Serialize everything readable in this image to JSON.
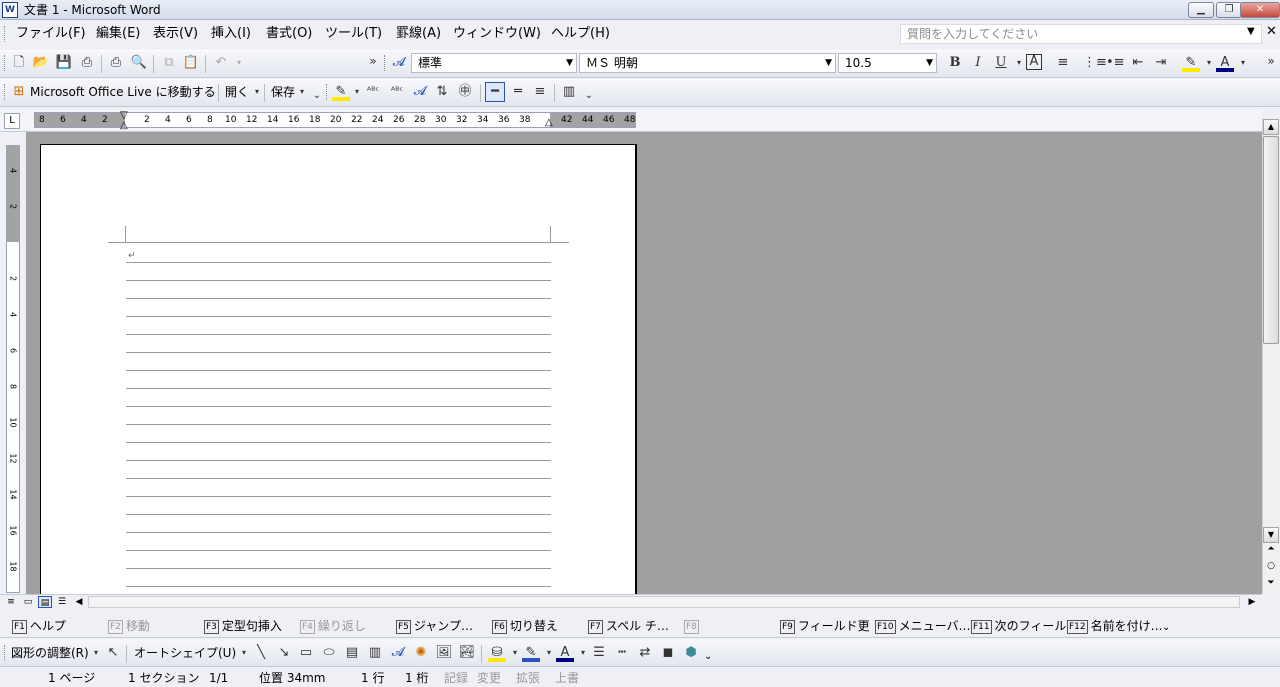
{
  "window": {
    "title": "文書 1 - Microsoft Word",
    "icon": "word-doc-icon",
    "minimize": "minimize-icon",
    "restore": "restore-icon",
    "close": "close-icon"
  },
  "menu": {
    "items": [
      "ファイル(F)",
      "編集(E)",
      "表示(V)",
      "挿入(I)",
      "書式(O)",
      "ツール(T)",
      "罫線(A)",
      "ウィンドウ(W)",
      "ヘルプ(H)"
    ],
    "question_placeholder": "質問を入力してください"
  },
  "formatting": {
    "style": "標準",
    "font": "ＭＳ 明朝",
    "size": "10.5",
    "bold": "B",
    "italic": "I",
    "underline": "U"
  },
  "web_toolbar": {
    "office_live": "Microsoft Office Live に移動する",
    "open": "開く",
    "save": "保存"
  },
  "ruler": {
    "h_labels": [
      "8",
      "6",
      "4",
      "2",
      "2",
      "4",
      "6",
      "8",
      "10",
      "12",
      "14",
      "16",
      "18",
      "20",
      "22",
      "24",
      "26",
      "28",
      "30",
      "32",
      "34",
      "36",
      "38",
      "42",
      "44",
      "46",
      "48"
    ],
    "v_labels": [
      "4",
      "2",
      "2",
      "4",
      "6",
      "8",
      "10",
      "12",
      "14",
      "16",
      "18"
    ],
    "tab_selector": "L"
  },
  "fkeys": [
    {
      "key": "F1",
      "label": "ヘルプ",
      "enabled": true
    },
    {
      "key": "F2",
      "label": "移動",
      "enabled": false
    },
    {
      "key": "F3",
      "label": "定型句挿入",
      "enabled": true
    },
    {
      "key": "F4",
      "label": "繰り返し",
      "enabled": false
    },
    {
      "key": "F5",
      "label": "ジャンプ…",
      "enabled": true
    },
    {
      "key": "F6",
      "label": "切り替え",
      "enabled": true
    },
    {
      "key": "F7",
      "label": "スペル チ…",
      "enabled": true
    },
    {
      "key": "F8",
      "label": "",
      "enabled": false
    },
    {
      "key": "F9",
      "label": "フィールド更",
      "enabled": true
    },
    {
      "key": "F10",
      "label": "メニューバ…",
      "enabled": true
    },
    {
      "key": "F11",
      "label": "次のフィール",
      "enabled": true
    },
    {
      "key": "F12",
      "label": "名前を付け…",
      "enabled": true
    }
  ],
  "drawing": {
    "adjust": "図形の調整(R)",
    "autoshape": "オートシェイプ(U)"
  },
  "status": {
    "page": "1 ページ",
    "section": "1 セクション",
    "pages": "1/1",
    "position": "位置 34mm",
    "line": "1 行",
    "column": "1 桁",
    "rec": "記録",
    "trk": "変更",
    "ext": "拡張",
    "ovr": "上書"
  }
}
